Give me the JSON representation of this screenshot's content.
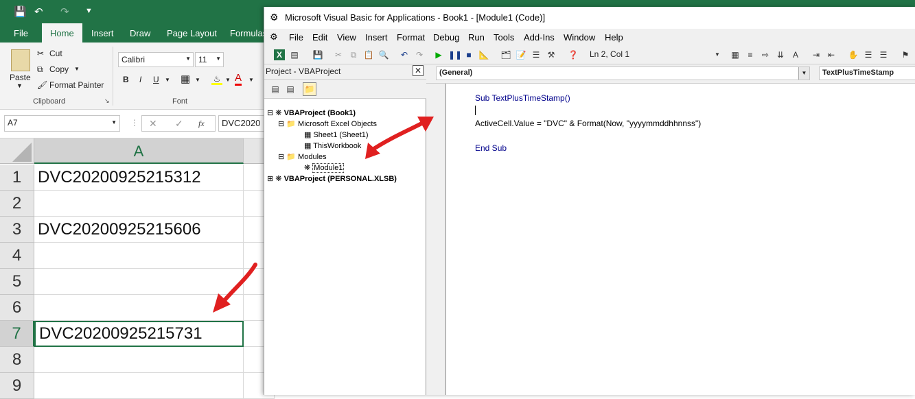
{
  "excel": {
    "tabs": [
      "File",
      "Home",
      "Insert",
      "Draw",
      "Page Layout",
      "Formulas"
    ],
    "active_tab": "Home",
    "clipboard": {
      "paste": "Paste",
      "cut": "Cut",
      "copy": "Copy",
      "format_painter": "Format Painter",
      "group": "Clipboard"
    },
    "font": {
      "name": "Calibri",
      "size": "11",
      "bold": "B",
      "italic": "I",
      "underline": "U",
      "group": "Font"
    },
    "name_box": "A7",
    "formula_preview": "DVC2020",
    "fx": "fx",
    "column_header": "A",
    "rows": [
      {
        "num": "1",
        "value": "DVC20200925215312"
      },
      {
        "num": "2",
        "value": ""
      },
      {
        "num": "3",
        "value": "DVC20200925215606"
      },
      {
        "num": "4",
        "value": ""
      },
      {
        "num": "5",
        "value": ""
      },
      {
        "num": "6",
        "value": ""
      },
      {
        "num": "7",
        "value": "DVC20200925215731"
      },
      {
        "num": "8",
        "value": ""
      },
      {
        "num": "9",
        "value": ""
      }
    ]
  },
  "vba": {
    "title": "Microsoft Visual Basic for Applications - Book1 - [Module1 (Code)]",
    "menu": [
      "File",
      "Edit",
      "View",
      "Insert",
      "Format",
      "Debug",
      "Run",
      "Tools",
      "Add-Ins",
      "Window",
      "Help"
    ],
    "position": "Ln 2, Col 1",
    "project_title": "Project - VBAProject",
    "tree": {
      "root": "VBAProject (Book1)",
      "excel_objects": "Microsoft Excel Objects",
      "sheet1": "Sheet1 (Sheet1)",
      "workbook": "ThisWorkbook",
      "modules": "Modules",
      "module1": "Module1",
      "personal": "VBAProject (PERSONAL.XLSB)"
    },
    "object_combo": "(General)",
    "proc_combo": "TextPlusTimeStamp",
    "code": {
      "line1": "Sub TextPlusTimeStamp()",
      "line2": "ActiveCell.Value = \"DVC\" & Format(Now, \"yyyymmddhhnnss\")",
      "line3": "End Sub"
    }
  },
  "colors": {
    "excel_green": "#217346",
    "arrow": "#e02020"
  }
}
